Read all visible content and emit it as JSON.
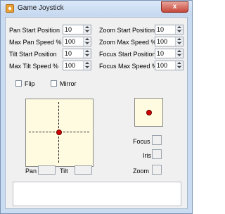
{
  "window": {
    "title": "Game Joystick",
    "close_label": "x"
  },
  "pan_tilt": {
    "pan_start_label": "Pan Start Position",
    "pan_start_value": "10",
    "max_pan_label": "Max Pan Speed %",
    "max_pan_value": "100",
    "tilt_start_label": "Tilt Start Position",
    "tilt_start_value": "10",
    "max_tilt_label": "Max Tilt Speed %",
    "max_tilt_value": "100"
  },
  "zoom_focus": {
    "zoom_start_label": "Zoom Start Position",
    "zoom_start_value": "10",
    "zoom_max_label": "Zoom Max Speed %",
    "zoom_max_value": "100",
    "focus_start_label": "Focus Start Position",
    "focus_start_value": "10",
    "focus_max_label": "Focus Max Speed %",
    "focus_max_value": "100"
  },
  "options": {
    "flip_label": "Flip",
    "flip_checked": false,
    "mirror_label": "Mirror",
    "mirror_checked": false
  },
  "readouts": {
    "pan_label": "Pan",
    "pan_value": "",
    "tilt_label": "Tilt",
    "tilt_value": "",
    "focus_label": "Focus",
    "focus_value": "",
    "iris_label": "Iris",
    "iris_value": "",
    "zoom_label": "Zoom",
    "zoom_value": ""
  },
  "status": {
    "text": ""
  },
  "colors": {
    "pad_background": "#fffbe0",
    "indicator": "#d40000"
  }
}
